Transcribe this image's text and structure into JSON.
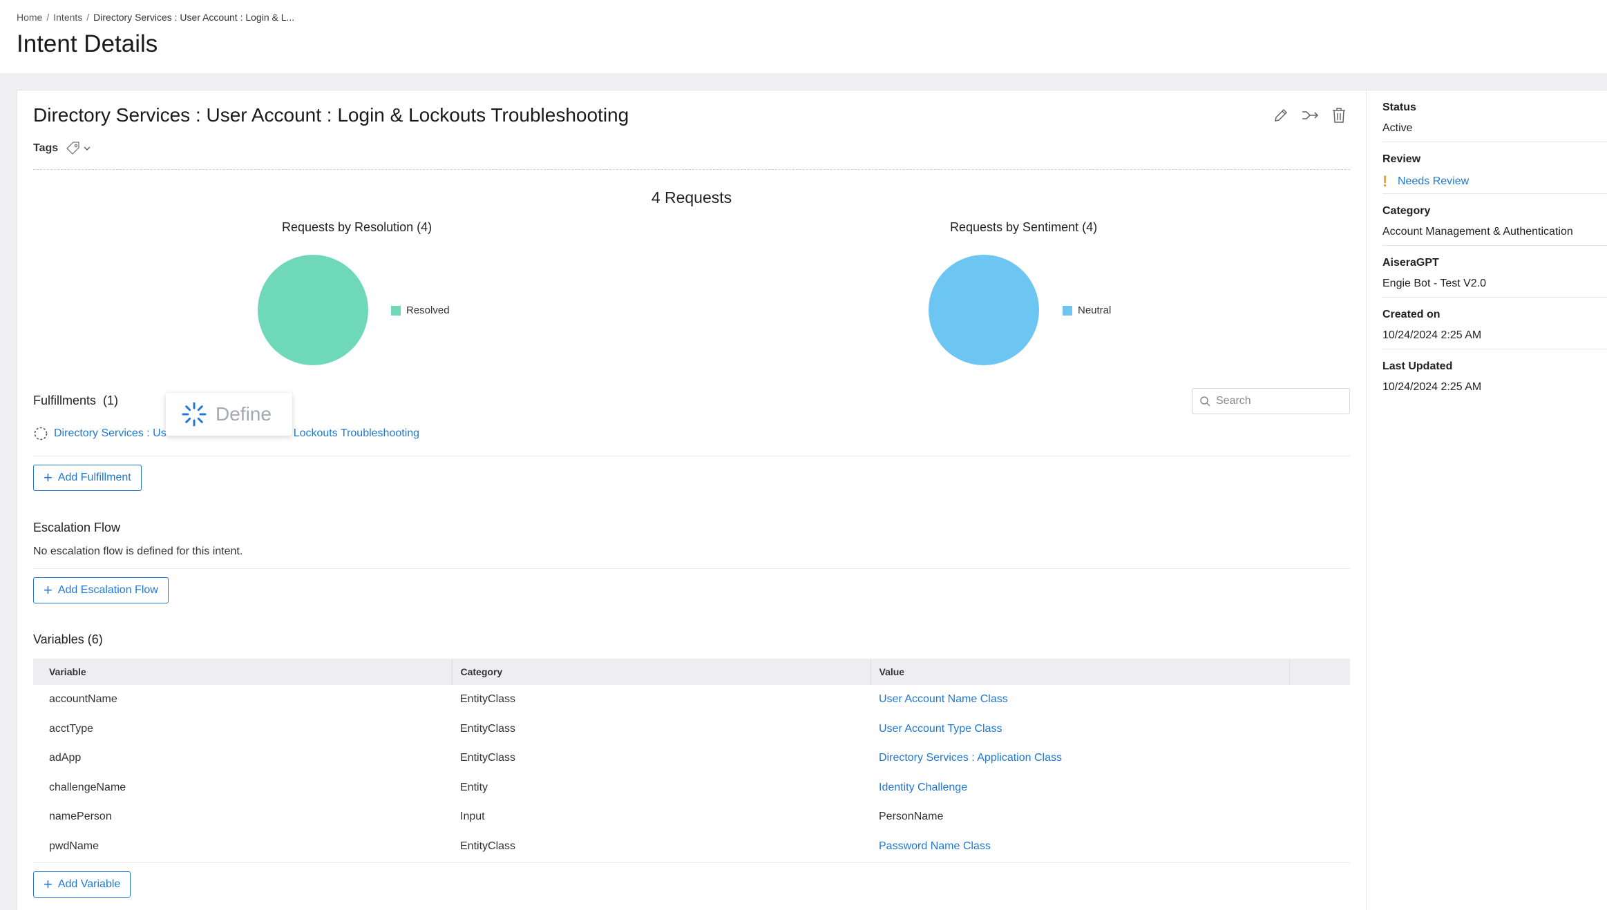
{
  "breadcrumb": {
    "home": "Home",
    "intents": "Intents",
    "current": "Directory Services : User Account : Login & L..."
  },
  "page_title": "Intent Details",
  "intent": {
    "title": "Directory Services : User Account : Login & Lockouts Troubleshooting",
    "tags_label": "Tags",
    "icons": [
      "edit-icon",
      "merge-icon",
      "trash-icon"
    ]
  },
  "requests": {
    "title": "4 Requests",
    "resolution": {
      "title": "Requests by Resolution (4)",
      "legend": "Resolved",
      "color": "#6fd8b8"
    },
    "sentiment": {
      "title": "Requests by Sentiment (4)",
      "legend": "Neutral",
      "color": "#6cc6f1"
    }
  },
  "chart_data": [
    {
      "type": "pie",
      "title": "Requests by Resolution (4)",
      "categories": [
        "Resolved"
      ],
      "values": [
        4
      ],
      "legend": "right"
    },
    {
      "type": "pie",
      "title": "Requests by Sentiment (4)",
      "categories": [
        "Neutral"
      ],
      "values": [
        4
      ],
      "legend": "right"
    }
  ],
  "fulfillments": {
    "title": "Fulfillments",
    "count": "(1)",
    "search_placeholder": "Search",
    "link_part1": "Directory Services : Us",
    "link_part2": "Lockouts Troubleshooting",
    "add_label": "Add Fulfillment"
  },
  "define_popup": {
    "label": "Define"
  },
  "escalation": {
    "title": "Escalation Flow",
    "note": "No escalation flow is defined for this intent.",
    "add_label": "Add Escalation Flow"
  },
  "variables": {
    "title": "Variables (6)",
    "columns": [
      "Variable",
      "Category",
      "Value"
    ],
    "rows": [
      {
        "variable": "accountName",
        "category": "EntityClass",
        "value": "User Account Name Class",
        "link": true
      },
      {
        "variable": "acctType",
        "category": "EntityClass",
        "value": "User Account Type Class",
        "link": true
      },
      {
        "variable": "adApp",
        "category": "EntityClass",
        "value": "Directory Services : Application Class",
        "link": true
      },
      {
        "variable": "challengeName",
        "category": "Entity",
        "value": "Identity Challenge",
        "link": true
      },
      {
        "variable": "namePerson",
        "category": "Input",
        "value": "PersonName",
        "link": false
      },
      {
        "variable": "pwdName",
        "category": "EntityClass",
        "value": "Password Name Class",
        "link": true
      }
    ],
    "add_label": "Add Variable"
  },
  "side": {
    "status": {
      "label": "Status",
      "value": "Active"
    },
    "review": {
      "label": "Review",
      "value": "Needs Review"
    },
    "category": {
      "label": "Category",
      "value": "Account Management & Authentication"
    },
    "aiseragpt": {
      "label": "AiseraGPT",
      "value": "Engie Bot - Test V2.0"
    },
    "created": {
      "label": "Created on",
      "value": "10/24/2024 2:25 AM"
    },
    "updated": {
      "label": "Last Updated",
      "value": "10/24/2024 2:25 AM"
    }
  },
  "colors": {
    "link": "#1f78d1",
    "warning": "#f0a020",
    "resolved": "#6fd8b8",
    "neutral": "#6cc6f1"
  }
}
